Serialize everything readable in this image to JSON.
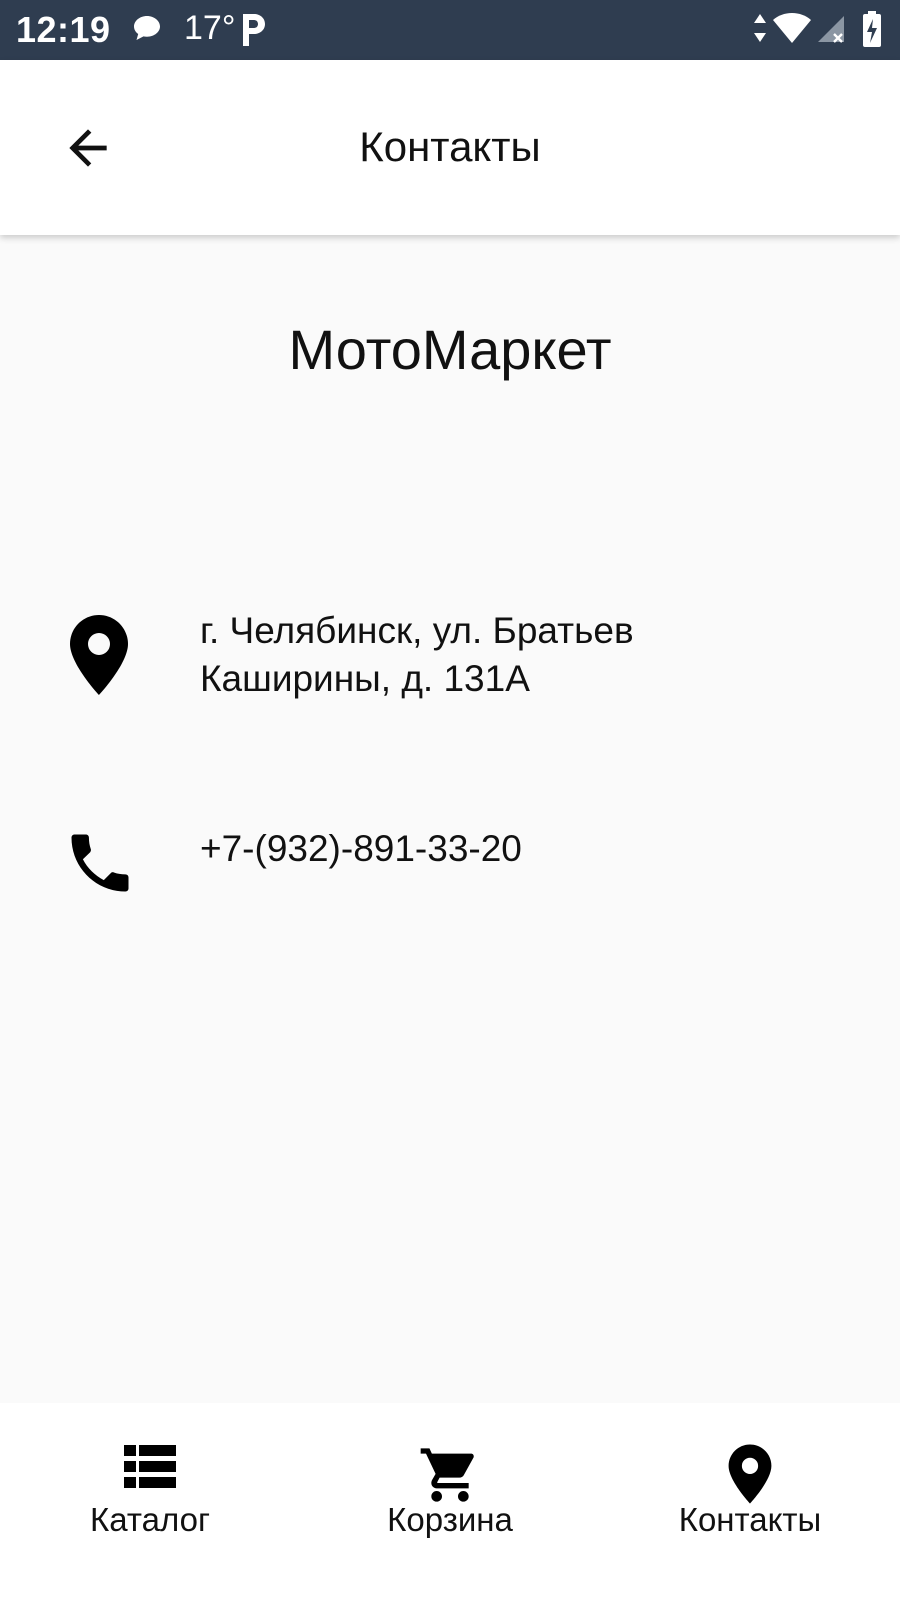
{
  "status_bar": {
    "time": "12:19",
    "temperature": "17°",
    "icons": [
      "message-icon",
      "parking-icon",
      "data-arrows-icon",
      "wifi-icon",
      "cell-signal-icon",
      "battery-charging-icon"
    ],
    "background_color": "#2f3d50"
  },
  "app_bar": {
    "title": "Контакты",
    "back_icon": "arrow-back-icon"
  },
  "content": {
    "store_name": "МотоМаркет",
    "address": {
      "icon": "location-pin-icon",
      "line1": "г. Челябинск, ул. Братьев",
      "line2": "Каширины, д. 131А"
    },
    "phone": {
      "icon": "phone-icon",
      "number": "+7-(932)-891-33-20"
    }
  },
  "bottom_nav": {
    "items": [
      {
        "label": "Каталог",
        "icon": "list-icon"
      },
      {
        "label": "Корзина",
        "icon": "cart-icon"
      },
      {
        "label": "Контакты",
        "icon": "location-pin-icon"
      }
    ]
  }
}
